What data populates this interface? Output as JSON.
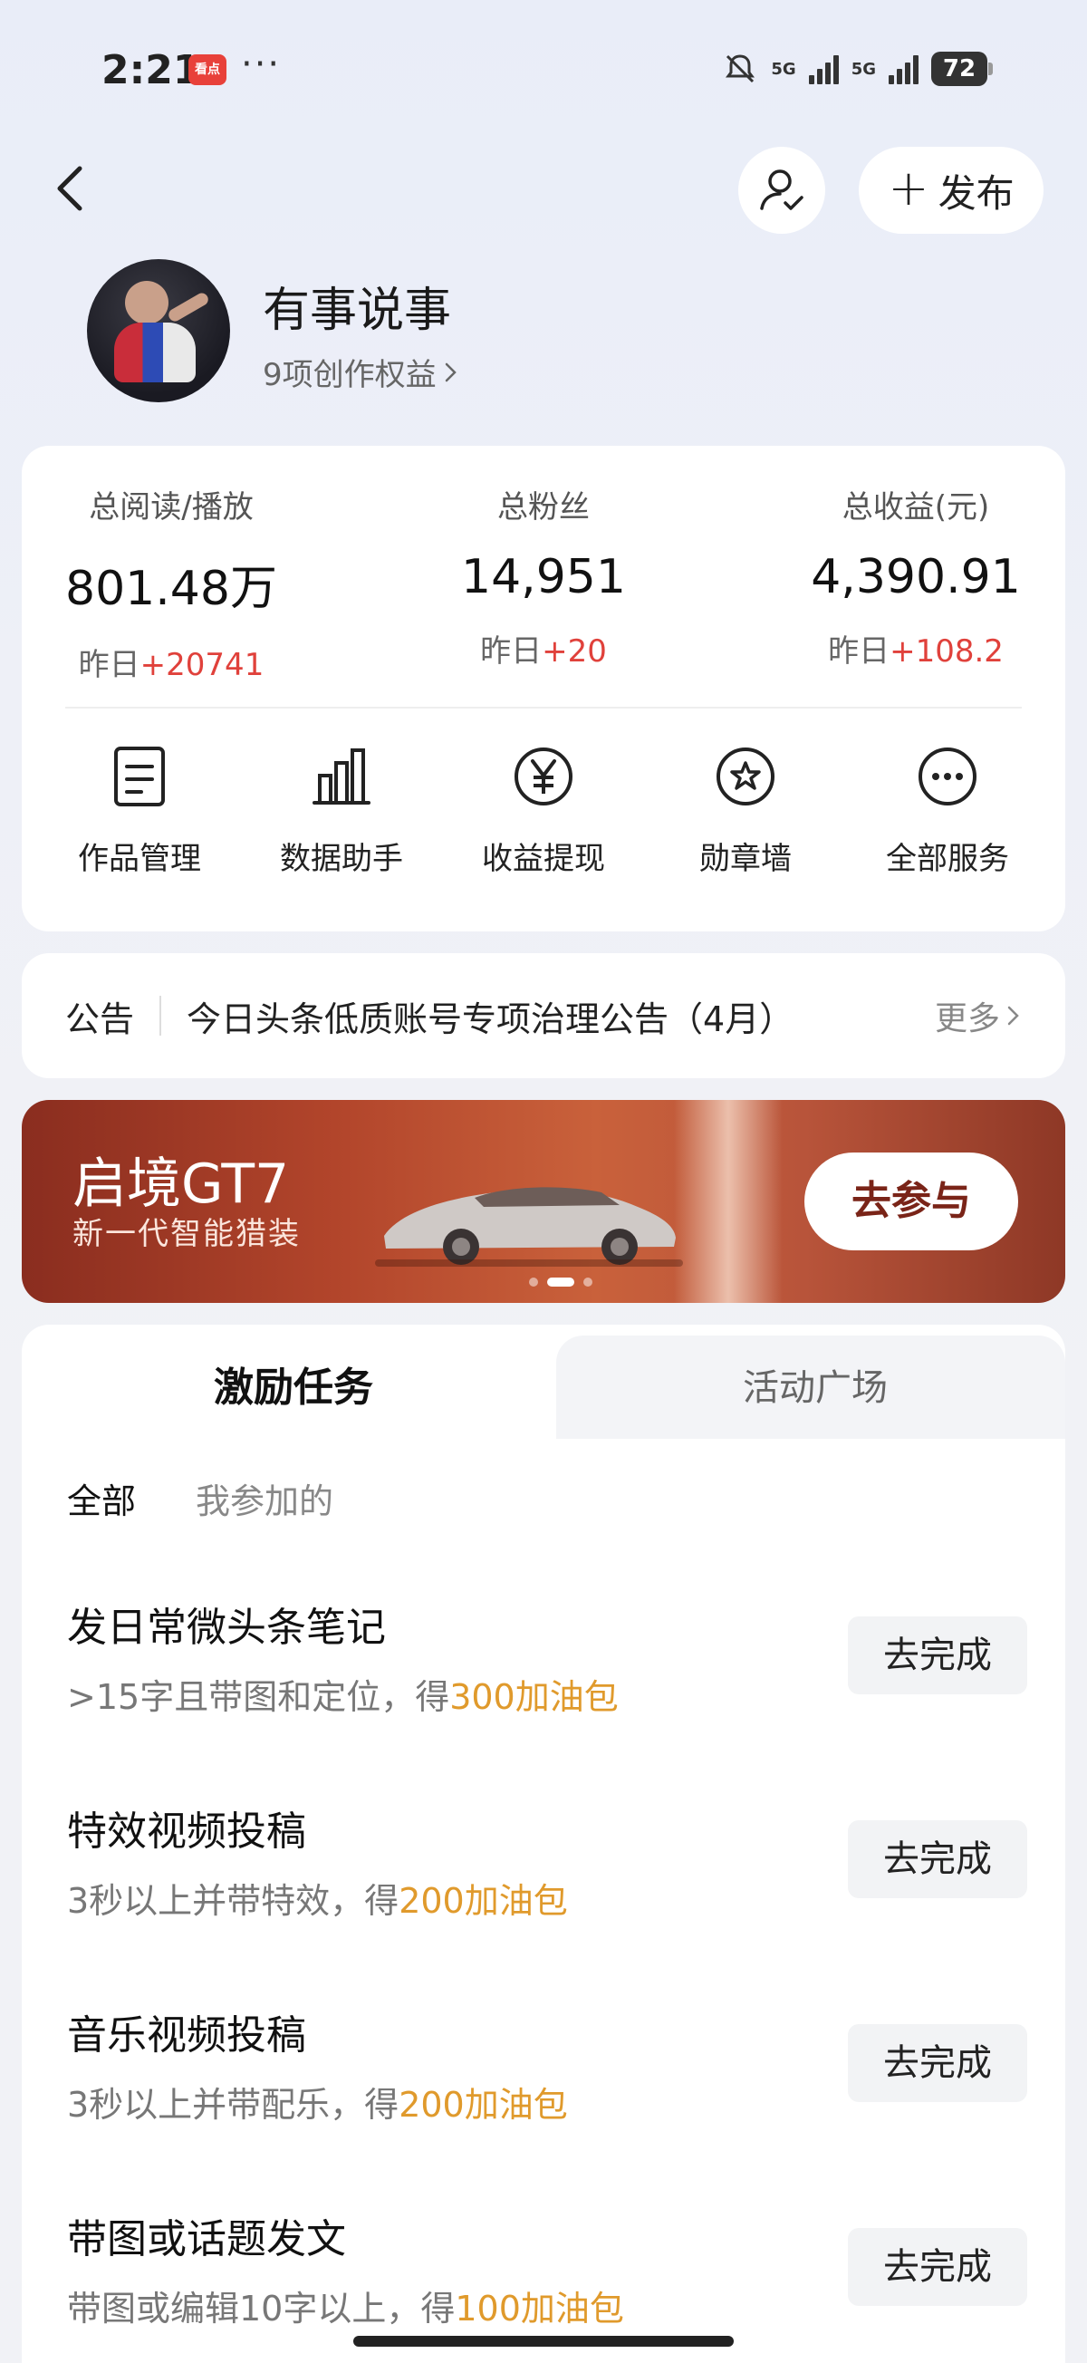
{
  "status_bar": {
    "time": "2:21",
    "app_badge": "看点",
    "more": "···",
    "network1": "5G",
    "network2": "5G",
    "battery": "72"
  },
  "header": {
    "publish_label": "发布"
  },
  "profile": {
    "name": "有事说事",
    "rights": "9项创作权益"
  },
  "stats": [
    {
      "label": "总阅读/播放",
      "value": "801.48万",
      "delta_prefix": "昨日",
      "delta": "+20741"
    },
    {
      "label": "总粉丝",
      "value": "14,951",
      "delta_prefix": "昨日",
      "delta": "+20"
    },
    {
      "label": "总收益(元)",
      "value": "4,390.91",
      "delta_prefix": "昨日",
      "delta": "+108.2"
    }
  ],
  "services": [
    {
      "label": "作品管理",
      "icon": "document-icon"
    },
    {
      "label": "数据助手",
      "icon": "bar-chart-icon"
    },
    {
      "label": "收益提现",
      "icon": "yen-icon"
    },
    {
      "label": "勋章墙",
      "icon": "medal-icon"
    },
    {
      "label": "全部服务",
      "icon": "more-circle-icon"
    }
  ],
  "notice": {
    "tag": "公告",
    "text": "今日头条低质账号专项治理公告（4月）",
    "more": "更多"
  },
  "banner": {
    "title": "启境GT7",
    "subtitle": "新一代智能猎装",
    "cta": "去参与"
  },
  "tasks": {
    "tabs": [
      "激励任务",
      "活动广场"
    ],
    "filters": [
      "全部",
      "我参加的"
    ],
    "items": [
      {
        "title": "发日常微头条笔记",
        "desc": ">15字且带图和定位，得",
        "reward": "300加油包",
        "cta": "去完成"
      },
      {
        "title": "特效视频投稿",
        "desc": "3秒以上并带特效，得",
        "reward": "200加油包",
        "cta": "去完成"
      },
      {
        "title": "音乐视频投稿",
        "desc": "3秒以上并带配乐，得",
        "reward": "200加油包",
        "cta": "去完成"
      },
      {
        "title": "带图或话题发文",
        "desc": "带图或编辑10字以上，得",
        "reward": "100加油包",
        "cta": "去完成"
      }
    ]
  },
  "colors": {
    "accent_red": "#e0413b",
    "reward_gold": "#e09a2c",
    "banner": "#b2452b"
  }
}
